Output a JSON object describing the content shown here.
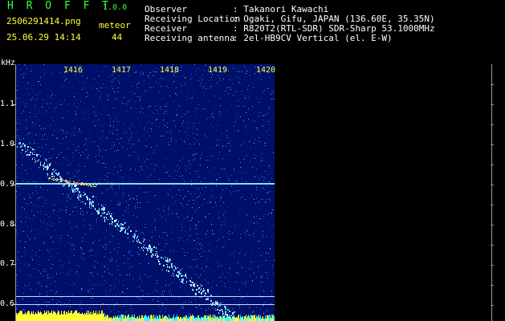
{
  "header": {
    "app_title": "H R O F F T",
    "version": "1.0.0",
    "filename": "2506291414.png",
    "timestamp": "25.06.29 14:14",
    "meteor_label": "meteor",
    "meteor_count": "44"
  },
  "info": [
    {
      "label": "Observer",
      "value": ": Takanori Kawachi"
    },
    {
      "label": "Receiving Location",
      "value": ": Ogaki, Gifu, JAPAN (136.60E, 35.35N)"
    },
    {
      "label": "Receiver",
      "value": ": R820T2(RTL-SDR) SDR-Sharp 53.1000MHz"
    },
    {
      "label": "Receiving antenna",
      "value": ": 2el-HB9CV Vertical (el. E-W)"
    }
  ],
  "axis": {
    "y_unit": "kHz",
    "y_ticks": [
      "1.1",
      "1.0",
      "0.9",
      "0.8",
      "0.7",
      "0.6"
    ],
    "x_ticks": [
      "1416",
      "1417",
      "1418",
      "1419",
      "1420"
    ]
  },
  "colors": {
    "background": "#000000",
    "spectrogram_bg": "#00106a",
    "title_green": "#3cff3c",
    "label_yellow": "#ffff33",
    "carrier_cyan": "#7fe0ff"
  }
}
